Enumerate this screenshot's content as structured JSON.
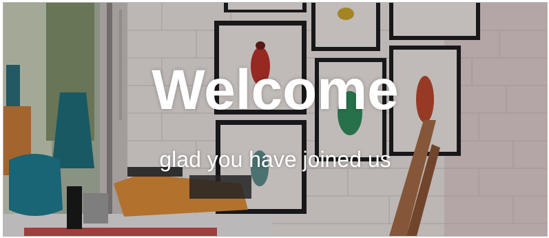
{
  "hero": {
    "title": "Welcome",
    "subtitle": "glad you have joined us"
  },
  "colors": {
    "wall": "#e9e3e2",
    "brick_line": "#d4cbc9",
    "frame": "#1e1d1f",
    "typewriter": "#d98a37",
    "vase": "#1e6d7a",
    "text": "#ffffff",
    "border": "#b9b9b9"
  },
  "icons": [
    "beetle-art",
    "typewriter-shape",
    "vase-shape",
    "chair-shape",
    "window-shape"
  ]
}
